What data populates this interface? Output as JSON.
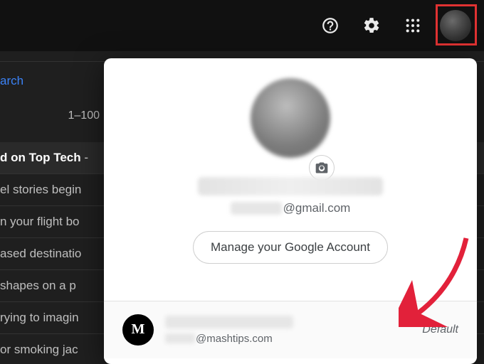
{
  "topbar": {
    "help_icon": "help-icon",
    "settings_icon": "gear-icon",
    "apps_icon": "apps-grid-icon",
    "avatar_icon": "profile-avatar"
  },
  "background": {
    "search_link": "arch",
    "count_label": "1–100",
    "rows": [
      "d on Top Tech",
      "el stories begin",
      "n your flight bo",
      "ased destinatio",
      "shapes on a p",
      "rying to imagin",
      "or smoking jac"
    ],
    "row0_suffix": " - "
  },
  "card": {
    "email_domain": "@gmail.com",
    "camera_icon": "camera-icon",
    "manage_label": "Manage your Google Account",
    "secondary_account": {
      "avatar_letter": "M",
      "email_domain": "@mashtips.com",
      "tag": "Default"
    }
  }
}
